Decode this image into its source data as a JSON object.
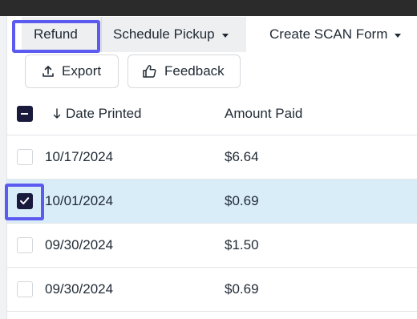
{
  "toolbar": {
    "refund_label": "Refund",
    "schedule_pickup_label": "Schedule Pickup",
    "create_scan_form_label": "Create SCAN Form",
    "export_label": "Export",
    "feedback_label": "Feedback"
  },
  "table": {
    "columns": [
      "Date Printed",
      "Amount Paid"
    ],
    "sort_column": "Date Printed",
    "sort_direction": "descending",
    "header_checkbox_state": "indeterminate",
    "rows": [
      {
        "date": "10/17/2024",
        "amount": "$6.64",
        "checked": false
      },
      {
        "date": "10/01/2024",
        "amount": "$0.69",
        "checked": true
      },
      {
        "date": "09/30/2024",
        "amount": "$1.50",
        "checked": false
      },
      {
        "date": "09/30/2024",
        "amount": "$0.69",
        "checked": false
      }
    ]
  },
  "colors": {
    "highlight": "#5b5bf0",
    "checkbox_fill": "#1a1a3d",
    "selected_row": "#d9edf9",
    "toolbar_button_bg": "#eeeff1"
  },
  "icons": {
    "export": "upload-icon",
    "feedback": "thumbs-up-icon",
    "sort": "arrow-down-icon",
    "dropdown": "chevron-down-icon"
  }
}
